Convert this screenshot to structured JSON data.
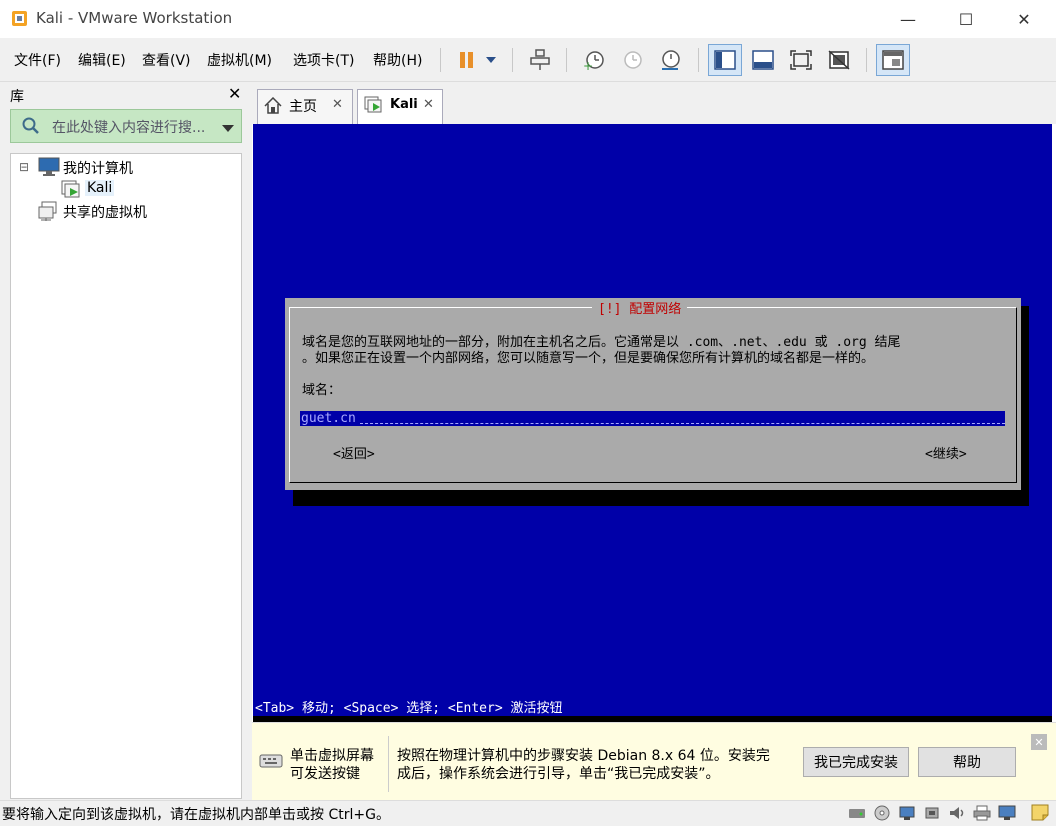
{
  "window": {
    "title": "Kali - VMware Workstation",
    "minimize": "—",
    "maximize": "☐",
    "close": "✕"
  },
  "menu": [
    "文件(F)",
    "编辑(E)",
    "查看(V)",
    "虚拟机(M)",
    "选项卡(T)",
    "帮助(H)"
  ],
  "library": {
    "title": "库",
    "close": "✕",
    "search_placeholder": "在此处键入内容进行搜...",
    "tree": [
      {
        "label": "我的计算机",
        "expander": "⊟"
      },
      {
        "label": "Kali"
      },
      {
        "label": "共享的虚拟机"
      }
    ]
  },
  "tabs": [
    {
      "label": "主页",
      "close": "✕"
    },
    {
      "label": "Kali",
      "close": "✕"
    }
  ],
  "installer": {
    "dialog_title": "[!] 配置网络",
    "line1": "域名是您的互联网地址的一部分，附加在主机名之后。它通常是以 .com、.net、.edu 或 .org 结尾",
    "line2": "。如果您正在设置一个内部网络，您可以随意写一个，但是要确保您所有计算机的域名都是一样的。",
    "field_label": "域名：",
    "field_value": "guet.cn",
    "back_button": "<返回>",
    "continue_button": "<继续>",
    "status_line": "<Tab> 移动; <Space> 选择; <Enter> 激活按钮"
  },
  "hint": {
    "left_text": "单击虚拟屏幕\n可发送按键",
    "left_line1": "单击虚拟屏幕",
    "left_line2": "可发送按键",
    "message_line1": "按照在物理计算机中的步骤安装 Debian 8.x 64 位。安装完",
    "message_line2": "成后，操作系统会进行引导，单击“我已完成安装”。",
    "done_button": "我已完成安装",
    "help_button": "帮助",
    "close": "✕"
  },
  "statusbar": {
    "message": "要将输入定向到该虚拟机，请在虚拟机内部单击或按 Ctrl+G。"
  },
  "colors": {
    "vm_background": "#0000a8",
    "dialog_gray": "#aaaaaa",
    "dialog_title_red": "#c00000",
    "library_search_green": "#c6e7c4",
    "hint_bar": "#fffde1"
  }
}
